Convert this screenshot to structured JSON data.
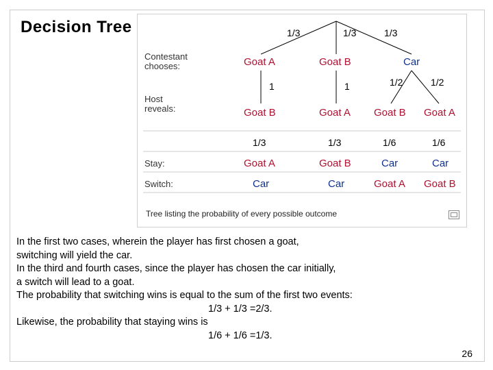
{
  "title": "Decision Tree",
  "figure": {
    "rowLabels": {
      "contestant": "Contestant\nchooses:",
      "host": "Host\nreveals:",
      "stay": "Stay:",
      "switch": "Switch:"
    },
    "topProbs": [
      "1/3",
      "1/3",
      "1/3"
    ],
    "chooses": [
      "Goat A",
      "Goat B",
      "Car"
    ],
    "hostProbs": [
      "1",
      "1",
      "1/2",
      "1/2"
    ],
    "reveals": [
      "Goat B",
      "Goat A",
      "Goat B",
      "Goat A"
    ],
    "leafProbs": [
      "1/3",
      "1/3",
      "1/6",
      "1/6"
    ],
    "stayRow": [
      "Goat A",
      "Goat B",
      "Car",
      "Car"
    ],
    "switchRow": [
      "Car",
      "Car",
      "Goat A",
      "Goat B"
    ],
    "caption": "Tree listing the probability of every possible outcome"
  },
  "body": {
    "l1": "In the first two cases, wherein the player has first chosen a goat,",
    "l2": "switching will yield the car.",
    "l3": "In the third and fourth cases, since the player has chosen the car initially,",
    "l4": "a switch will lead to a goat.",
    "l5": "The probability that switching wins is equal to the sum of the first two events:",
    "l6": "1/3 + 1/3 =2/3.",
    "l7": "Likewise, the probability that staying wins is",
    "l8": "1/6 + 1/6 =1/3."
  },
  "pageNumber": "26"
}
